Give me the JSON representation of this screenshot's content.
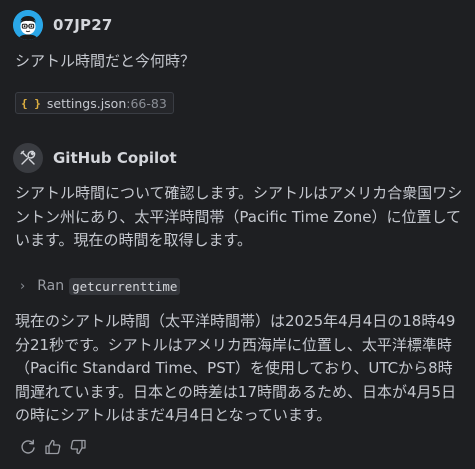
{
  "user": {
    "name": "07JP27",
    "message": "シアトル時間だと今何時？",
    "file_ref": {
      "icon": "json-braces-icon",
      "icon_glyph": "{ }",
      "file_name": "settings.json",
      "range": ":66-83"
    }
  },
  "assistant": {
    "name": "GitHub Copilot",
    "intro": "シアトル時間について確認します。シアトルはアメリカ合衆国ワシントン州にあり、太平洋時間帯（Pacific Time Zone）に位置しています。現在の時間を取得します。",
    "tool_call": {
      "label": "Ran",
      "tool": "getcurrenttime"
    },
    "answer": "現在のシアトル時間（太平洋時間帯）は2025年4月4日の18時49分21秒です。シアトルはアメリカ西海岸に位置し、太平洋標準時（Pacific Standard Time、PST）を使用しており、UTCから8時間遅れています。日本との時差は17時間あるため、日本が4月5日の時にシアトルはまだ4月4日となっています。"
  },
  "actions": [
    "retry-icon",
    "thumbs-up-icon",
    "thumbs-down-icon"
  ],
  "colors": {
    "background": "#1e1f22",
    "text": "#c5c8cf",
    "avatar_blue": "#2aa7e8",
    "json_icon": "#e3b341"
  }
}
